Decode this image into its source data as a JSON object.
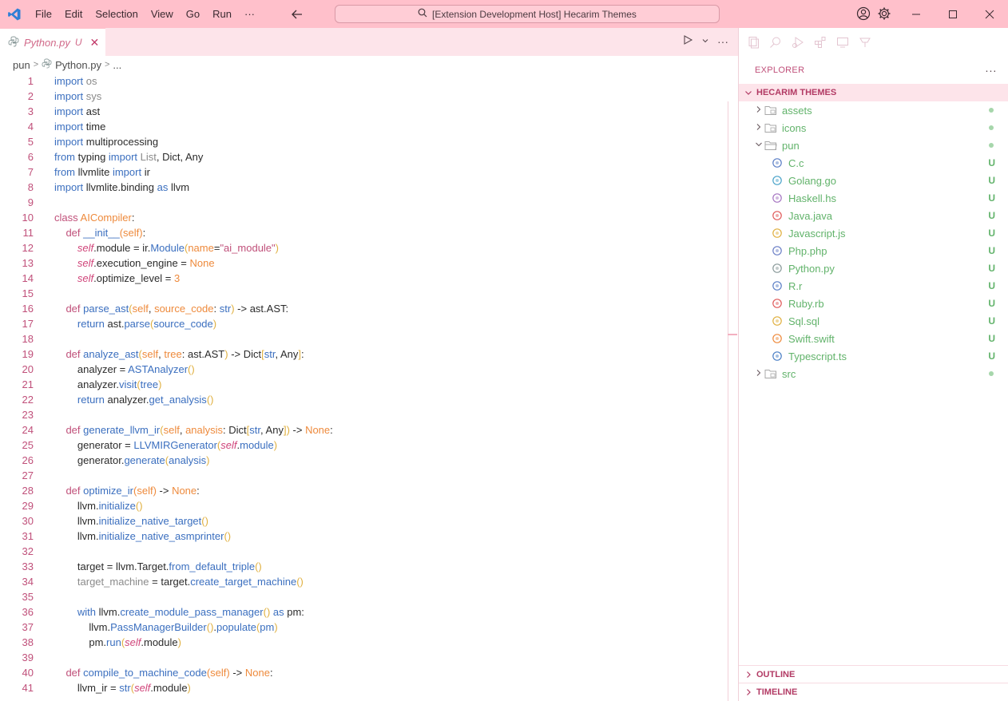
{
  "titlebar": {
    "menu": [
      "File",
      "Edit",
      "Selection",
      "View",
      "Go",
      "Run",
      "···"
    ],
    "command_center": "[Extension Development Host] Hecarim Themes",
    "accent": "#ffc0cb"
  },
  "tab": {
    "name": "Python.py",
    "status": "U"
  },
  "breadcrumb": {
    "folder": "pun",
    "file": "Python.py",
    "more": "..."
  },
  "code": [
    {
      "n": "1",
      "t": [
        [
          "kw",
          "import"
        ],
        [
          "op",
          " "
        ],
        [
          "dim",
          "os"
        ]
      ]
    },
    {
      "n": "2",
      "t": [
        [
          "kw",
          "import"
        ],
        [
          "op",
          " "
        ],
        [
          "dim",
          "sys"
        ]
      ]
    },
    {
      "n": "3",
      "t": [
        [
          "kw",
          "import"
        ],
        [
          "op",
          " ast"
        ]
      ]
    },
    {
      "n": "4",
      "t": [
        [
          "kw",
          "import"
        ],
        [
          "op",
          " time"
        ]
      ]
    },
    {
      "n": "5",
      "t": [
        [
          "kw",
          "import"
        ],
        [
          "op",
          " multiprocessing"
        ]
      ]
    },
    {
      "n": "6",
      "t": [
        [
          "kw",
          "from"
        ],
        [
          "op",
          " typing "
        ],
        [
          "kw",
          "import"
        ],
        [
          "dim",
          " List"
        ],
        [
          "op",
          ", Dict, Any"
        ]
      ]
    },
    {
      "n": "7",
      "t": [
        [
          "kw",
          "from"
        ],
        [
          "op",
          " llvmlite "
        ],
        [
          "kw",
          "import"
        ],
        [
          "op",
          " ir"
        ]
      ]
    },
    {
      "n": "8",
      "t": [
        [
          "kw",
          "import"
        ],
        [
          "op",
          " llvmlite.binding "
        ],
        [
          "kw",
          "as"
        ],
        [
          "op",
          " llvm"
        ]
      ]
    },
    {
      "n": "9",
      "t": []
    },
    {
      "n": "10",
      "t": [
        [
          "slf2",
          "class"
        ],
        [
          "op",
          " "
        ],
        [
          "cls",
          "AICompiler"
        ],
        [
          "op",
          ":"
        ]
      ]
    },
    {
      "n": "11",
      "t": [
        [
          "op",
          "    "
        ],
        [
          "slf2",
          "def"
        ],
        [
          "op",
          " "
        ],
        [
          "fn",
          "__init__"
        ],
        [
          "par",
          "(self)"
        ],
        [
          "op",
          ":"
        ]
      ]
    },
    {
      "n": "12",
      "t": [
        [
          "op",
          "        "
        ],
        [
          "slf",
          "self"
        ],
        [
          "op",
          ".module = ir."
        ],
        [
          "fn",
          "Module"
        ],
        [
          "br",
          "("
        ],
        [
          "par",
          "name"
        ],
        [
          "op",
          "="
        ],
        [
          "str",
          "\"ai_module\""
        ],
        [
          "br",
          ")"
        ]
      ]
    },
    {
      "n": "13",
      "t": [
        [
          "op",
          "        "
        ],
        [
          "slf",
          "self"
        ],
        [
          "op",
          ".execution_engine = "
        ],
        [
          "num",
          "None"
        ]
      ]
    },
    {
      "n": "14",
      "t": [
        [
          "op",
          "        "
        ],
        [
          "slf",
          "self"
        ],
        [
          "op",
          ".optimize_level = "
        ],
        [
          "num",
          "3"
        ]
      ]
    },
    {
      "n": "15",
      "t": []
    },
    {
      "n": "16",
      "t": [
        [
          "op",
          "    "
        ],
        [
          "slf2",
          "def"
        ],
        [
          "op",
          " "
        ],
        [
          "fn",
          "parse_ast"
        ],
        [
          "br",
          "("
        ],
        [
          "par",
          "self"
        ],
        [
          "op",
          ", "
        ],
        [
          "par",
          "source_code"
        ],
        [
          "op",
          ": "
        ],
        [
          "fn",
          "str"
        ],
        [
          "br",
          ")"
        ],
        [
          "op",
          " -> ast.AST:"
        ]
      ]
    },
    {
      "n": "17",
      "t": [
        [
          "op",
          "        "
        ],
        [
          "kw",
          "return"
        ],
        [
          "op",
          " ast."
        ],
        [
          "fn",
          "parse"
        ],
        [
          "br",
          "("
        ],
        [
          "fn",
          "source_code"
        ],
        [
          "br",
          ")"
        ]
      ]
    },
    {
      "n": "18",
      "t": []
    },
    {
      "n": "19",
      "t": [
        [
          "op",
          "    "
        ],
        [
          "slf2",
          "def"
        ],
        [
          "op",
          " "
        ],
        [
          "fn",
          "analyze_ast"
        ],
        [
          "br",
          "("
        ],
        [
          "par",
          "self"
        ],
        [
          "op",
          ", "
        ],
        [
          "par",
          "tree"
        ],
        [
          "op",
          ": ast.AST"
        ],
        [
          "br",
          ")"
        ],
        [
          "op",
          " -> Dict"
        ],
        [
          "br",
          "["
        ],
        [
          "fn",
          "str"
        ],
        [
          "op",
          ", Any"
        ],
        [
          "br",
          "]"
        ],
        [
          "op",
          ":"
        ]
      ]
    },
    {
      "n": "20",
      "t": [
        [
          "op",
          "        analyzer = "
        ],
        [
          "fn",
          "ASTAnalyzer"
        ],
        [
          "br",
          "()"
        ]
      ]
    },
    {
      "n": "21",
      "t": [
        [
          "op",
          "        analyzer."
        ],
        [
          "fn",
          "visit"
        ],
        [
          "br",
          "("
        ],
        [
          "fn",
          "tree"
        ],
        [
          "br",
          ")"
        ]
      ]
    },
    {
      "n": "22",
      "t": [
        [
          "op",
          "        "
        ],
        [
          "kw",
          "return"
        ],
        [
          "op",
          " analyzer."
        ],
        [
          "fn",
          "get_analysis"
        ],
        [
          "br",
          "()"
        ]
      ]
    },
    {
      "n": "23",
      "t": []
    },
    {
      "n": "24",
      "t": [
        [
          "op",
          "    "
        ],
        [
          "slf2",
          "def"
        ],
        [
          "op",
          " "
        ],
        [
          "fn",
          "generate_llvm_ir"
        ],
        [
          "br",
          "("
        ],
        [
          "par",
          "self"
        ],
        [
          "op",
          ", "
        ],
        [
          "par",
          "analysis"
        ],
        [
          "op",
          ": Dict"
        ],
        [
          "br",
          "["
        ],
        [
          "fn",
          "str"
        ],
        [
          "op",
          ", Any"
        ],
        [
          "br",
          "])"
        ],
        [
          "op",
          " -> "
        ],
        [
          "num",
          "None"
        ],
        [
          "op",
          ":"
        ]
      ]
    },
    {
      "n": "25",
      "t": [
        [
          "op",
          "        generator = "
        ],
        [
          "fn",
          "LLVMIRGenerator"
        ],
        [
          "br",
          "("
        ],
        [
          "slf",
          "self"
        ],
        [
          "op",
          "."
        ],
        [
          "fn",
          "module"
        ],
        [
          "br",
          ")"
        ]
      ]
    },
    {
      "n": "26",
      "t": [
        [
          "op",
          "        generator."
        ],
        [
          "fn",
          "generate"
        ],
        [
          "br",
          "("
        ],
        [
          "fn",
          "analysis"
        ],
        [
          "br",
          ")"
        ]
      ]
    },
    {
      "n": "27",
      "t": []
    },
    {
      "n": "28",
      "t": [
        [
          "op",
          "    "
        ],
        [
          "slf2",
          "def"
        ],
        [
          "op",
          " "
        ],
        [
          "fn",
          "optimize_ir"
        ],
        [
          "par",
          "(self)"
        ],
        [
          "op",
          " -> "
        ],
        [
          "num",
          "None"
        ],
        [
          "op",
          ":"
        ]
      ]
    },
    {
      "n": "29",
      "t": [
        [
          "op",
          "        llvm."
        ],
        [
          "fn",
          "initialize"
        ],
        [
          "br",
          "()"
        ]
      ]
    },
    {
      "n": "30",
      "t": [
        [
          "op",
          "        llvm."
        ],
        [
          "fn",
          "initialize_native_target"
        ],
        [
          "br",
          "()"
        ]
      ]
    },
    {
      "n": "31",
      "t": [
        [
          "op",
          "        llvm."
        ],
        [
          "fn",
          "initialize_native_asmprinter"
        ],
        [
          "br",
          "()"
        ]
      ]
    },
    {
      "n": "32",
      "t": []
    },
    {
      "n": "33",
      "t": [
        [
          "op",
          "        target = llvm.Target."
        ],
        [
          "fn",
          "from_default_triple"
        ],
        [
          "br",
          "()"
        ]
      ]
    },
    {
      "n": "34",
      "t": [
        [
          "op",
          "        "
        ],
        [
          "dim",
          "target_machine"
        ],
        [
          "op",
          " = target."
        ],
        [
          "fn",
          "create_target_machine"
        ],
        [
          "br",
          "()"
        ]
      ]
    },
    {
      "n": "35",
      "t": []
    },
    {
      "n": "36",
      "t": [
        [
          "op",
          "        "
        ],
        [
          "kw",
          "with"
        ],
        [
          "op",
          " llvm."
        ],
        [
          "fn",
          "create_module_pass_manager"
        ],
        [
          "br",
          "()"
        ],
        [
          "op",
          " "
        ],
        [
          "kw",
          "as"
        ],
        [
          "op",
          " pm:"
        ]
      ]
    },
    {
      "n": "37",
      "t": [
        [
          "op",
          "            llvm."
        ],
        [
          "fn",
          "PassManagerBuilder"
        ],
        [
          "br",
          "()"
        ],
        [
          "op",
          "."
        ],
        [
          "fn",
          "populate"
        ],
        [
          "br",
          "("
        ],
        [
          "fn",
          "pm"
        ],
        [
          "br",
          ")"
        ]
      ]
    },
    {
      "n": "38",
      "t": [
        [
          "op",
          "            pm."
        ],
        [
          "fn",
          "run"
        ],
        [
          "br",
          "("
        ],
        [
          "slf",
          "self"
        ],
        [
          "op",
          ".module"
        ],
        [
          "br",
          ")"
        ]
      ]
    },
    {
      "n": "39",
      "t": []
    },
    {
      "n": "40",
      "t": [
        [
          "op",
          "    "
        ],
        [
          "slf2",
          "def"
        ],
        [
          "op",
          " "
        ],
        [
          "fn",
          "compile_to_machine_code"
        ],
        [
          "par",
          "(self)"
        ],
        [
          "op",
          " -> "
        ],
        [
          "num",
          "None"
        ],
        [
          "op",
          ":"
        ]
      ]
    },
    {
      "n": "41",
      "t": [
        [
          "op",
          "        llvm_ir = "
        ],
        [
          "fn",
          "str"
        ],
        [
          "br",
          "("
        ],
        [
          "slf",
          "self"
        ],
        [
          "op",
          ".module"
        ],
        [
          "br",
          ")"
        ]
      ]
    }
  ],
  "explorer": {
    "header": "EXPLORER",
    "more": "···",
    "section": "HECARIM THEMES",
    "items": [
      {
        "name": "assets",
        "kind": "folder",
        "twisty": "closed",
        "depth": 0,
        "icon": "folder-assets-icon"
      },
      {
        "name": "icons",
        "kind": "folder",
        "twisty": "closed",
        "depth": 0,
        "icon": "folder-icons-icon"
      },
      {
        "name": "pun",
        "kind": "folder",
        "twisty": "open",
        "depth": 0,
        "icon": "folder-open-icon"
      },
      {
        "name": "C.c",
        "kind": "file",
        "depth": 1,
        "status": "U",
        "icon": "c-file-icon",
        "color": "#5b7fc6"
      },
      {
        "name": "Golang.go",
        "kind": "file",
        "depth": 1,
        "status": "U",
        "icon": "go-file-icon",
        "color": "#4aa3c9"
      },
      {
        "name": "Haskell.hs",
        "kind": "file",
        "depth": 1,
        "status": "U",
        "icon": "haskell-file-icon",
        "color": "#a676c2"
      },
      {
        "name": "Java.java",
        "kind": "file",
        "depth": 1,
        "status": "U",
        "icon": "java-file-icon",
        "color": "#e05a5a"
      },
      {
        "name": "Javascript.js",
        "kind": "file",
        "depth": 1,
        "status": "U",
        "icon": "javascript-file-icon",
        "color": "#e0b040"
      },
      {
        "name": "Php.php",
        "kind": "file",
        "depth": 1,
        "status": "U",
        "icon": "php-file-icon",
        "color": "#6b7fc6"
      },
      {
        "name": "Python.py",
        "kind": "file",
        "depth": 1,
        "status": "U",
        "icon": "python-file-icon",
        "color": "#8a9a9a"
      },
      {
        "name": "R.r",
        "kind": "file",
        "depth": 1,
        "status": "U",
        "icon": "r-file-icon",
        "color": "#5b7fc6"
      },
      {
        "name": "Ruby.rb",
        "kind": "file",
        "depth": 1,
        "status": "U",
        "icon": "ruby-file-icon",
        "color": "#e05a5a"
      },
      {
        "name": "Sql.sql",
        "kind": "file",
        "depth": 1,
        "status": "U",
        "icon": "sql-file-icon",
        "color": "#e0b040"
      },
      {
        "name": "Swift.swift",
        "kind": "file",
        "depth": 1,
        "status": "U",
        "icon": "swift-file-icon",
        "color": "#ee8a3c"
      },
      {
        "name": "Typescript.ts",
        "kind": "file",
        "depth": 1,
        "status": "U",
        "icon": "typescript-file-icon",
        "color": "#4a7fc6"
      },
      {
        "name": "src",
        "kind": "folder",
        "twisty": "closed",
        "depth": 0,
        "icon": "folder-src-icon"
      }
    ],
    "outline": "OUTLINE",
    "timeline": "TIMELINE"
  }
}
